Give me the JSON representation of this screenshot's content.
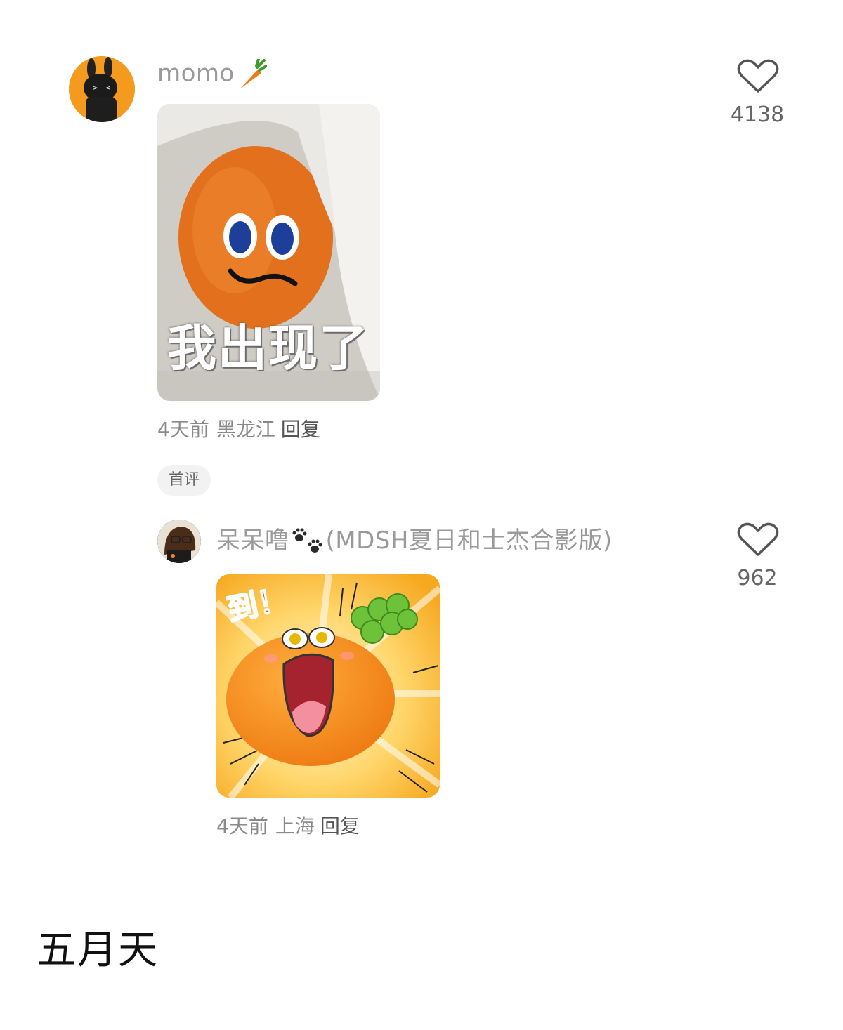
{
  "comments": [
    {
      "username": "momo",
      "username_emoji": "carrot",
      "likes": "4138",
      "image_caption": "我出现了",
      "meta": {
        "time": "4天前",
        "location": "黑龙江",
        "reply": "回复"
      },
      "badge": "首评"
    },
    {
      "username": "呆呆噜",
      "username_emoji": "paw-prints",
      "username_suffix": "(MDSH夏日和士杰合影版)",
      "likes": "962",
      "image_caption": "到！",
      "meta": {
        "time": "4天前",
        "location": "上海",
        "reply": "回复"
      }
    }
  ],
  "section_title": "五月天",
  "colors": {
    "accent_orange": "#f08a1c",
    "text_gray": "#9a9a9a",
    "badge_bg": "#f2f2f2"
  }
}
